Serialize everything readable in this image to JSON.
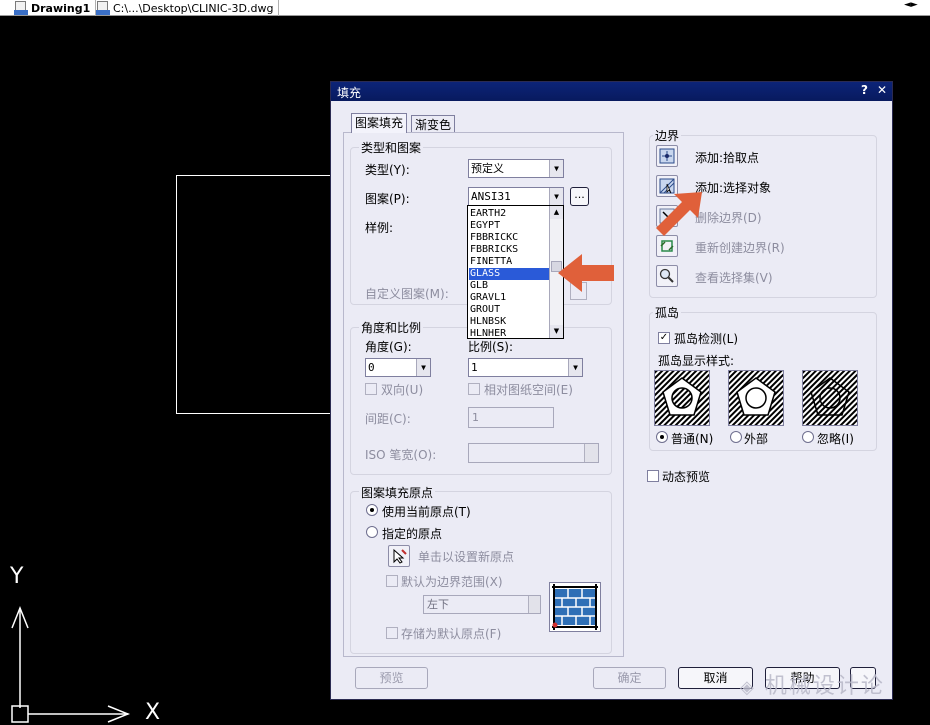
{
  "tabs": [
    {
      "label": "Drawing1"
    },
    {
      "label": "C:\\...\\Desktop\\CLINIC-3D.dwg"
    }
  ],
  "ucs": {
    "x_label": "X",
    "y_label": "Y"
  },
  "dialog": {
    "title": "填充",
    "help": "?",
    "close": "✕",
    "tabs": [
      "图案填充",
      "渐变色"
    ],
    "type_pattern": {
      "group_title": "类型和图案",
      "type_label": "类型(Y):",
      "type_value": "预定义",
      "pattern_label": "图案(P):",
      "pattern_value": "ANSI31",
      "browse": "...",
      "swatch_label": "样例:",
      "custom_label": "自定义图案(M):"
    },
    "pattern_list": {
      "items": [
        "EARTH2",
        "EGYPT",
        "FBBRICKC",
        "FBBRICKS",
        "FINETTA",
        "GLASS",
        "GLB",
        "GRAVL1",
        "GROUT",
        "HLNBSK",
        "HLNHER"
      ],
      "selected": "GLASS"
    },
    "angle_scale": {
      "group_title": "角度和比例",
      "angle_label": "角度(G):",
      "angle_value": "0",
      "scale_label": "比例(S):",
      "scale_value": "1",
      "double_label": "双向(U)",
      "relative_label": "相对图纸空间(E)",
      "spacing_label": "间距(C):",
      "spacing_value": "1",
      "iso_label": "ISO 笔宽(O):"
    },
    "origin": {
      "group_title": "图案填充原点",
      "use_current": "使用当前原点(T)",
      "specified": "指定的原点",
      "click_set": "单击以设置新原点",
      "default_extents": "默认为边界范围(X)",
      "position": "左下",
      "store_default": "存储为默认原点(F)"
    },
    "boundaries": {
      "group_title": "边界",
      "add_pick": "添加:拾取点",
      "add_select": "添加:选择对象",
      "remove": "删除边界(D)",
      "recreate": "重新创建边界(R)",
      "view": "查看选择集(V)"
    },
    "islands": {
      "group_title": "孤岛",
      "detect_label": "孤岛检测(L)",
      "style_label": "孤岛显示样式:",
      "normal": "普通(N)",
      "outer": "外部",
      "ignore": "忽略(I)"
    },
    "dynamic_preview": "动态预览",
    "buttons": {
      "preview": "预览",
      "ok": "确定",
      "cancel": "取消",
      "help": "帮助"
    }
  },
  "watermark": "机械设计论",
  "colors": {
    "titlebar": "#0c2478",
    "selection": "#2a5ad8",
    "arrow": "#e0603a"
  }
}
